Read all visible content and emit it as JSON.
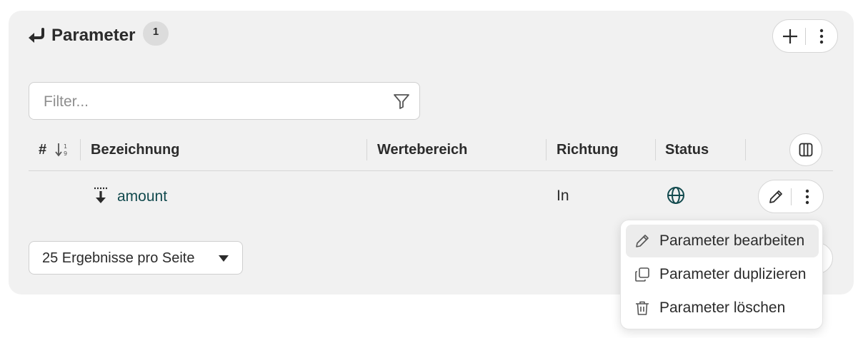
{
  "header": {
    "title": "Parameter",
    "count": "1"
  },
  "filter": {
    "placeholder": "Filter..."
  },
  "table": {
    "columns": {
      "index": "#",
      "name": "Bezeichnung",
      "range": "Wertebereich",
      "direction": "Richtung",
      "status": "Status"
    },
    "rows": [
      {
        "name": "amount",
        "range": "",
        "direction": "In",
        "status_icon": "globe-icon"
      }
    ]
  },
  "pagination": {
    "per_page_label": "25 Ergebnisse pro Seite"
  },
  "context_menu": {
    "items": [
      {
        "label": "Parameter bearbeiten",
        "icon": "pencil-icon"
      },
      {
        "label": "Parameter duplizieren",
        "icon": "copy-icon"
      },
      {
        "label": "Parameter löschen",
        "icon": "trash-icon"
      }
    ]
  },
  "colors": {
    "panel_bg": "#f1f1f1",
    "accent": "#124a4e",
    "text": "#2b2b2b"
  }
}
